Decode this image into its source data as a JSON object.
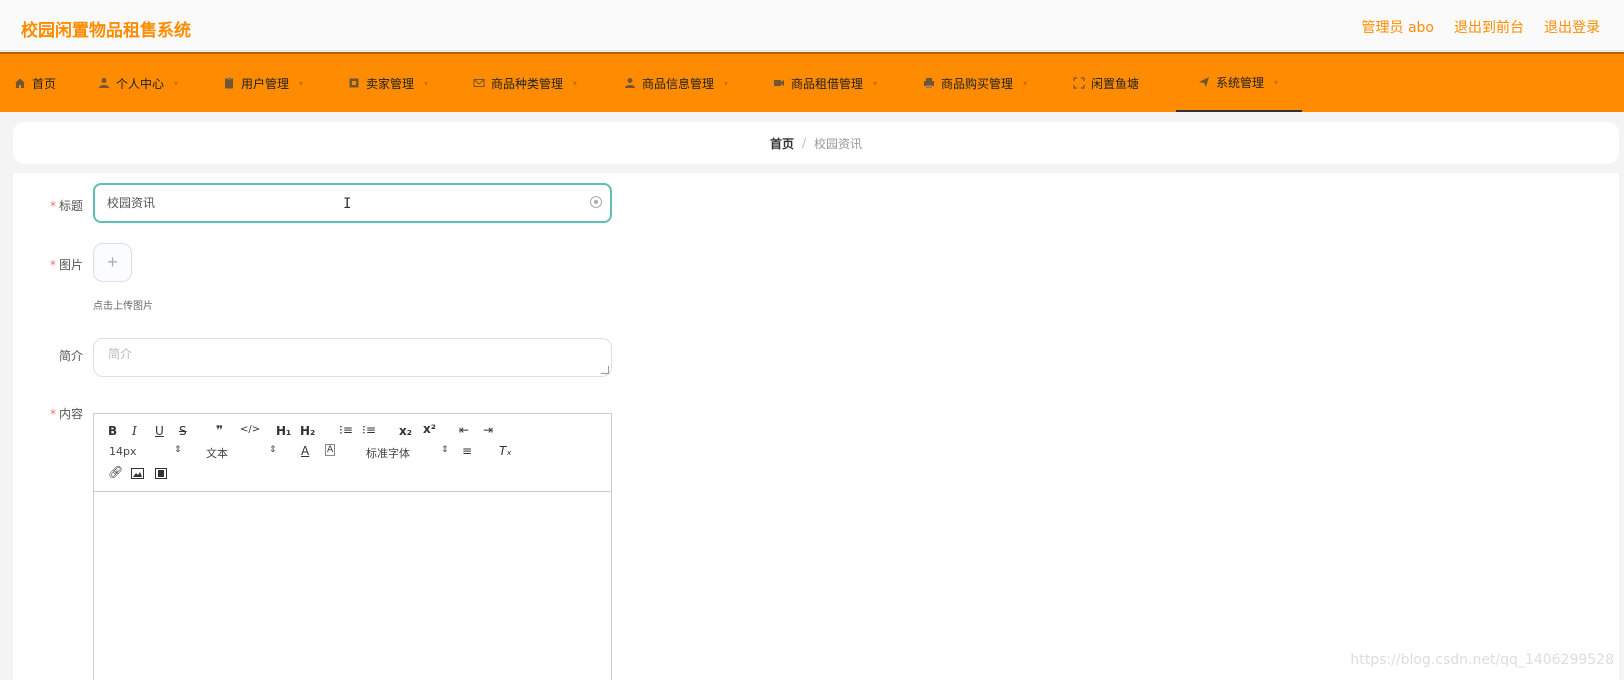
{
  "header": {
    "title": "校园闲置物品租售系统",
    "admin_label": "管理员 abo",
    "to_front": "退出到前台",
    "logout": "退出登录"
  },
  "nav": {
    "items": [
      {
        "label": "首页",
        "icon": "home-icon"
      },
      {
        "label": "个人中心",
        "icon": "user-icon"
      },
      {
        "label": "用户管理",
        "icon": "clipboard-icon"
      },
      {
        "label": "卖家管理",
        "icon": "store-icon"
      },
      {
        "label": "商品种类管理",
        "icon": "mail-icon"
      },
      {
        "label": "商品信息管理",
        "icon": "person-icon"
      },
      {
        "label": "商品租借管理",
        "icon": "video-icon"
      },
      {
        "label": "商品购买管理",
        "icon": "printer-icon"
      },
      {
        "label": "闲置鱼塘",
        "icon": "frame-icon"
      },
      {
        "label": "系统管理",
        "icon": "send-icon"
      }
    ],
    "active": "系统管理"
  },
  "breadcrumb": {
    "home": "首页",
    "separator": "/",
    "current": "校园资讯"
  },
  "form": {
    "title_label": "标题",
    "title_value": "校园资讯",
    "image_label": "图片",
    "upload_tip": "点击上传图片",
    "intro_label": "简介",
    "intro_placeholder": "简介",
    "content_label": "内容",
    "required_mark": "*"
  },
  "editor": {
    "font_size": "14px",
    "header_select": "文本",
    "font_family": "标准字体"
  },
  "watermark": "https://blog.csdn.net/qq_1406299528",
  "colors": {
    "accent": "#ff8c00",
    "input_focus": "#5fbfb1"
  }
}
